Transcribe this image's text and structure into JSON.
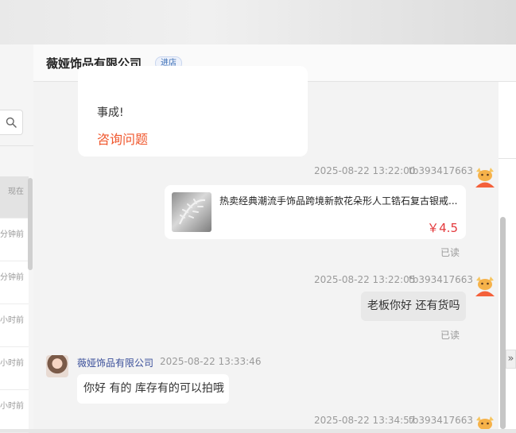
{
  "header": {
    "shop_name": "薇娅饰品有限公司",
    "enter_shop_label": "进店"
  },
  "sidebar": {
    "conversations": [
      {
        "time": "现在"
      },
      {
        "time": "分钟前"
      },
      {
        "time": "分钟前"
      },
      {
        "time": "小时前"
      },
      {
        "time": "小时前"
      },
      {
        "time": "小时前"
      }
    ]
  },
  "messages": {
    "consult_text": "事成!",
    "consult_link": "咨询问题",
    "msg1": {
      "timestamp": "2025-08-22 13:22:00",
      "sender": "tb393417663",
      "product_title": "热卖经典潮流手饰品跨境新款花朵形人工锆石复古银戒...",
      "product_price": "￥4.5",
      "read": "已读"
    },
    "msg2": {
      "timestamp": "2025-08-22 13:22:05",
      "sender": "tb393417663",
      "text": "老板你好 还有货吗",
      "read": "已读"
    },
    "msg3": {
      "sender": "薇娅饰品有限公司",
      "timestamp": "2025-08-22 13:33:46",
      "text": "你好 有的 库存有的可以拍哦"
    },
    "msg4": {
      "timestamp": "2025-08-22 13:34:57",
      "sender": "tb393417663"
    }
  },
  "icons": {
    "search": "search-icon",
    "expand": "double-chevron-right-icon",
    "user_avatar": "mascot-avatar-icon"
  },
  "colors": {
    "accent_orange": "#f0572d",
    "price_red": "#e4393c",
    "shop_name_blue": "#3a4f9a"
  }
}
